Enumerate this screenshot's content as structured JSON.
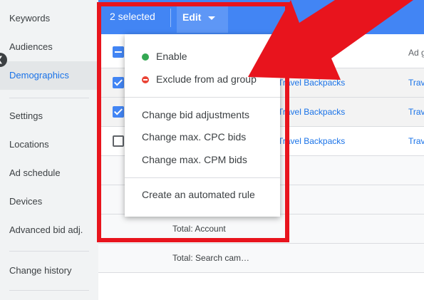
{
  "sidebar": {
    "items": [
      {
        "label": "Keywords"
      },
      {
        "label": "Audiences"
      },
      {
        "label": "Demographics"
      },
      {
        "label": "Settings"
      },
      {
        "label": "Locations"
      },
      {
        "label": "Ad schedule"
      },
      {
        "label": "Devices"
      },
      {
        "label": "Advanced bid adj."
      },
      {
        "label": "Change history"
      }
    ],
    "active_item": "Demographics",
    "collapse_icon": "chevron-left-icon"
  },
  "toolbar": {
    "selected_text": "2 selected",
    "edit_label": "Edit",
    "background_color": "#4285f4"
  },
  "table": {
    "partial_column_header": "Ad g",
    "rows": [
      {
        "checked": true,
        "ad_group": "Travel Backpacks",
        "partial_col": "Trav"
      },
      {
        "checked": true,
        "ad_group": "Travel Backpacks",
        "partial_col": "Trav"
      },
      {
        "checked": false,
        "ad_group": "Travel Backpacks",
        "partial_col": "Trav"
      }
    ],
    "totals": {
      "account": "Total: Account",
      "search_campaigns": "Total: Search cam…"
    }
  },
  "dropdown": {
    "items": [
      {
        "label": "Enable",
        "icon": "green-dot-icon"
      },
      {
        "label": "Exclude from ad group",
        "icon": "red-minus-icon"
      },
      {
        "label": "Change bid adjustments"
      },
      {
        "label": "Change max. CPC bids"
      },
      {
        "label": "Change max. CPM bids"
      },
      {
        "label": "Create an automated rule"
      }
    ]
  },
  "annotation": {
    "color": "#e8141d"
  }
}
